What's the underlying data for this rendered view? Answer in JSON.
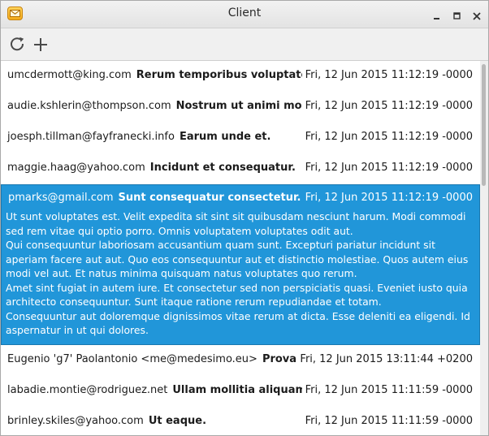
{
  "window": {
    "title": "Client",
    "app_icon": "envelope-icon"
  },
  "toolbar": {
    "refresh_icon": "refresh-icon",
    "add_icon": "plus-icon"
  },
  "messages": [
    {
      "from": "umcdermott@king.com",
      "subject": "Rerum temporibus voluptatem incidunt",
      "date": "Fri, 12 Jun 2015 11:12:19 -0000"
    },
    {
      "from": "audie.kshlerin@thompson.com",
      "subject": "Nostrum ut animi modi.",
      "date": "Fri, 12 Jun 2015 11:12:19 -0000"
    },
    {
      "from": "joesph.tillman@fayfranecki.info",
      "subject": "Earum unde et.",
      "date": "Fri, 12 Jun 2015 11:12:19 -0000"
    },
    {
      "from": "maggie.haag@yahoo.com",
      "subject": "Incidunt et consequatur.",
      "date": "Fri, 12 Jun 2015 11:12:19 -0000"
    }
  ],
  "selected_message": {
    "from": "pmarks@gmail.com",
    "subject": "Sunt consequatur consectetur.",
    "date": "Fri, 12 Jun 2015 11:12:19 -0000",
    "body": [
      "Ut sunt voluptates est. Velit expedita sit sint sit quibusdam nesciunt harum. Modi commodi sed rem vitae qui optio porro. Omnis voluptatem voluptates odit aut.",
      "Qui consequuntur laboriosam accusantium quam sunt. Excepturi pariatur incidunt sit aperiam facere aut aut. Quo eos consequuntur aut et distinctio molestiae. Quos autem eius modi vel aut. Et natus minima quisquam natus voluptates quo rerum.",
      "Amet sint fugiat in autem iure. Et consectetur sed non perspiciatis quasi. Eveniet iusto quia architecto consequuntur. Sunt itaque ratione rerum repudiandae et totam.",
      "Consequuntur aut doloremque dignissimos vitae rerum at dicta. Esse deleniti ea eligendi. Id aspernatur in ut qui dolores."
    ]
  },
  "messages_after": [
    {
      "from": "Eugenio 'g7' Paolantonio <me@medesimo.eu>",
      "subject": "Prova!",
      "date": "Fri, 12 Jun 2015 13:11:44 +0200"
    },
    {
      "from": "labadie.montie@rodriguez.net",
      "subject": "Ullam mollitia aliquam a.",
      "date": "Fri, 12 Jun 2015 11:11:59 -0000"
    },
    {
      "from": "brinley.skiles@yahoo.com",
      "subject": "Ut eaque.",
      "date": "Fri, 12 Jun 2015 11:11:59 -0000"
    }
  ]
}
